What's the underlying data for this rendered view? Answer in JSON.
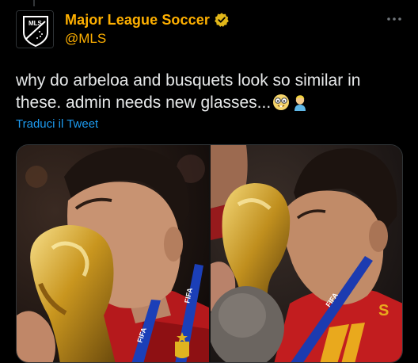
{
  "author": {
    "display_name": "Major League Soccer",
    "handle": "@MLS",
    "avatar_text": "MLS"
  },
  "tweet": {
    "text": "why do arbeloa and busquets look so similar in these. admin needs new glasses...",
    "emojis": [
      "nerd-face-emoji",
      "person-blond-emoji"
    ]
  },
  "actions": {
    "translate_label": "Traduci il Tweet"
  },
  "media": {
    "images": [
      {
        "name": "photo-arbeloa",
        "caption_marks": [
          "FIFA",
          "FIFA"
        ]
      },
      {
        "name": "photo-busquets",
        "caption_marks": [
          "FIFA"
        ]
      }
    ]
  },
  "colors": {
    "name": "#ffb000",
    "text": "#e7e9ea",
    "link": "#1d9bf0",
    "background": "#000000"
  },
  "icons": [
    "verified-badge-icon",
    "more-options-icon"
  ]
}
